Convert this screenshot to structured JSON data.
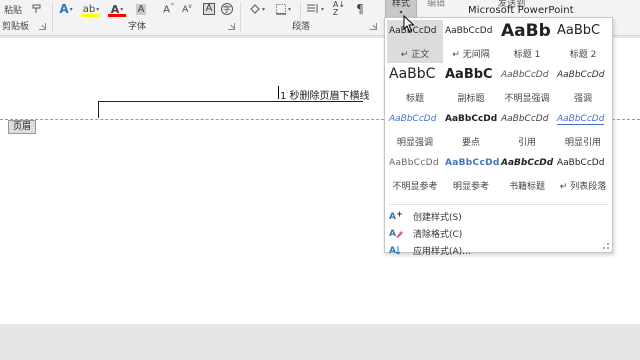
{
  "ribbon": {
    "paste_label": "粘贴",
    "groups": {
      "clipboard": "剪贴板",
      "font": "字体",
      "paragraph": "段落"
    },
    "styles_button_label": "样式",
    "editing_button_label": "编辑",
    "powerpoint_label_top": "发送到",
    "powerpoint_label": "Microsoft PowerPoint",
    "colors": {
      "highlight": "#ffff00",
      "font_color": "#ff0000"
    }
  },
  "document": {
    "header_text": "1 秒删除页眉下横线",
    "header_tag": "页眉"
  },
  "styles_gallery": {
    "rows": [
      [
        {
          "preview": "AaBbCcDd",
          "name": "↵ 正文",
          "kind": "normal",
          "selected": true
        },
        {
          "preview": "AaBbCcDd",
          "name": "↵ 无间隔",
          "kind": "normal",
          "selected": false
        },
        {
          "preview": "AaBb",
          "name": "标题 1",
          "kind": "h1",
          "selected": false
        },
        {
          "preview": "AaBbC",
          "name": "标题 2",
          "kind": "h2",
          "selected": false
        }
      ],
      [
        {
          "preview": "AaBbC",
          "name": "标题",
          "kind": "title",
          "selected": false
        },
        {
          "preview": "AaBbC",
          "name": "副标题",
          "kind": "subtitle",
          "selected": false
        },
        {
          "preview": "AaBbCcDd",
          "name": "不明显强调",
          "kind": "italic",
          "selected": false
        },
        {
          "preview": "AaBbCcDd",
          "name": "强调",
          "kind": "emph",
          "selected": false
        }
      ],
      [
        {
          "preview": "AaBbCcDd",
          "name": "明显强调",
          "kind": "intense-emph",
          "selected": false
        },
        {
          "preview": "AaBbCcDd",
          "name": "要点",
          "kind": "strong",
          "selected": false
        },
        {
          "preview": "AaBbCcDd",
          "name": "引用",
          "kind": "quote",
          "selected": false
        },
        {
          "preview": "AaBbCcDd",
          "name": "明显引用",
          "kind": "intense-quote",
          "selected": false
        }
      ],
      [
        {
          "preview": "AaBbCcDd",
          "name": "不明显参考",
          "kind": "sub-ref",
          "selected": false
        },
        {
          "preview": "AaBbCcDd",
          "name": "明显参考",
          "kind": "int-ref",
          "selected": false
        },
        {
          "preview": "AaBbCcDd",
          "name": "书籍标题",
          "kind": "book",
          "selected": false
        },
        {
          "preview": "AaBbCcDd",
          "name": "↵ 列表段落",
          "kind": "list",
          "selected": false
        }
      ]
    ],
    "commands": [
      {
        "label": "创建样式(S)",
        "icon": "create-style-icon"
      },
      {
        "label": "清除格式(C)",
        "icon": "clear-formatting-icon"
      },
      {
        "label": "应用样式(A)...",
        "icon": "apply-styles-icon"
      }
    ]
  }
}
